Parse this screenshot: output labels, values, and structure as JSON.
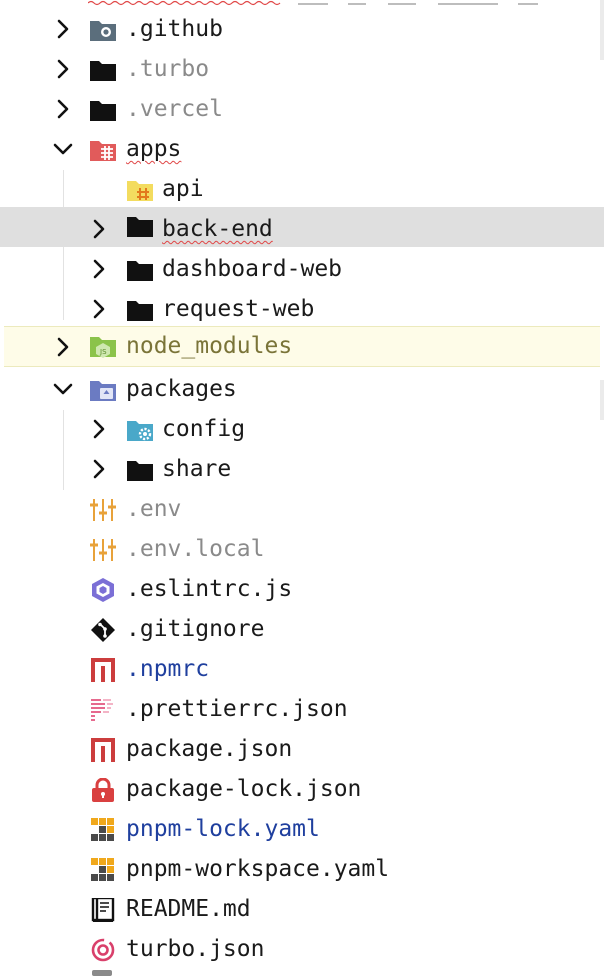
{
  "tree": {
    "items": [
      {
        "label": ".github",
        "icon": "github-folder-icon",
        "type": "folder",
        "state": "collapsed"
      },
      {
        "label": ".turbo",
        "icon": "folder-icon",
        "type": "folder",
        "state": "collapsed"
      },
      {
        "label": ".vercel",
        "icon": "folder-icon",
        "type": "folder",
        "state": "collapsed"
      },
      {
        "label": "apps",
        "icon": "apps-folder-icon",
        "type": "folder",
        "state": "expanded"
      },
      {
        "label": "api",
        "icon": "api-folder-icon",
        "type": "folder",
        "state": "none"
      },
      {
        "label": "back-end",
        "icon": "folder-icon",
        "type": "folder",
        "state": "collapsed",
        "selected": true
      },
      {
        "label": "dashboard-web",
        "icon": "folder-icon",
        "type": "folder",
        "state": "collapsed"
      },
      {
        "label": "request-web",
        "icon": "folder-icon",
        "type": "folder",
        "state": "collapsed"
      },
      {
        "label": "node_modules",
        "icon": "node-modules-folder-icon",
        "type": "folder",
        "state": "collapsed",
        "highlighted": true
      },
      {
        "label": "packages",
        "icon": "packages-folder-icon",
        "type": "folder",
        "state": "expanded"
      },
      {
        "label": "config",
        "icon": "config-folder-icon",
        "type": "folder",
        "state": "collapsed"
      },
      {
        "label": "share",
        "icon": "folder-icon",
        "type": "folder",
        "state": "collapsed"
      },
      {
        "label": ".env",
        "icon": "env-icon",
        "type": "file"
      },
      {
        "label": ".env.local",
        "icon": "env-icon",
        "type": "file"
      },
      {
        "label": ".eslintrc.js",
        "icon": "eslint-icon",
        "type": "file"
      },
      {
        "label": ".gitignore",
        "icon": "git-icon",
        "type": "file"
      },
      {
        "label": ".npmrc",
        "icon": "npm-icon",
        "type": "file"
      },
      {
        "label": ".prettierrc.json",
        "icon": "prettier-icon",
        "type": "file"
      },
      {
        "label": "package.json",
        "icon": "npm-icon",
        "type": "file"
      },
      {
        "label": "package-lock.json",
        "icon": "lock-icon",
        "type": "file"
      },
      {
        "label": "pnpm-lock.yaml",
        "icon": "pnpm-icon",
        "type": "file"
      },
      {
        "label": "pnpm-workspace.yaml",
        "icon": "pnpm-icon",
        "type": "file"
      },
      {
        "label": "README.md",
        "icon": "readme-icon",
        "type": "file"
      },
      {
        "label": "turbo.json",
        "icon": "turbo-icon",
        "type": "file"
      }
    ]
  },
  "colors": {
    "selected_row": "#dfdfdf",
    "highlighted_row": "#fefce8",
    "folder": "#1a1a1a",
    "muted_text": "#8a8a8a",
    "vcs_modified_text": "#1f3f9e",
    "excluded_text": "#7a7438",
    "error_squiggle": "#e04646"
  }
}
